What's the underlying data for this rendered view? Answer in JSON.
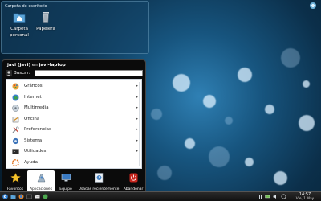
{
  "desktop": {
    "folder_view_title": "Carpeta de escritorio",
    "icons": [
      {
        "label_line1": "Carpeta",
        "label_line2": "personal",
        "icon": "home-folder-icon"
      },
      {
        "label_line1": "Papelera",
        "label_line2": "",
        "icon": "trash-icon"
      }
    ]
  },
  "kickoff": {
    "user": "javi (javi)",
    "connector": "en",
    "host": "javi-laptop",
    "search_label": "Buscar:",
    "search_value": "",
    "items": [
      {
        "label": "Gráficos",
        "icon": "graphics-icon"
      },
      {
        "label": "Internet",
        "icon": "internet-icon"
      },
      {
        "label": "Multimedia",
        "icon": "multimedia-icon"
      },
      {
        "label": "Oficina",
        "icon": "office-icon"
      },
      {
        "label": "Preferencias",
        "icon": "preferences-icon"
      },
      {
        "label": "Sistema",
        "icon": "system-icon"
      },
      {
        "label": "Utilidades",
        "icon": "utilities-icon"
      },
      {
        "label": "Ayuda",
        "icon": "help-icon"
      }
    ],
    "submenu_arrow": "▸",
    "tabs": [
      {
        "label": "Favoritos",
        "icon": "star-icon"
      },
      {
        "label": "Aplicaciones",
        "icon": "applications-icon"
      },
      {
        "label": "Equipo",
        "icon": "computer-icon"
      },
      {
        "label": "Usadas recientemente",
        "icon": "recent-icon"
      },
      {
        "label": "Abandonar",
        "icon": "power-icon"
      }
    ],
    "active_tab": "Aplicaciones"
  },
  "taskbar": {
    "time": "14:57",
    "date": "Vie, 1 May"
  },
  "colors": {
    "wallpaper": "#17557f",
    "menu_bg": "#0b0b0b",
    "list_bg": "#ffffff",
    "power_red": "#c8251d"
  }
}
